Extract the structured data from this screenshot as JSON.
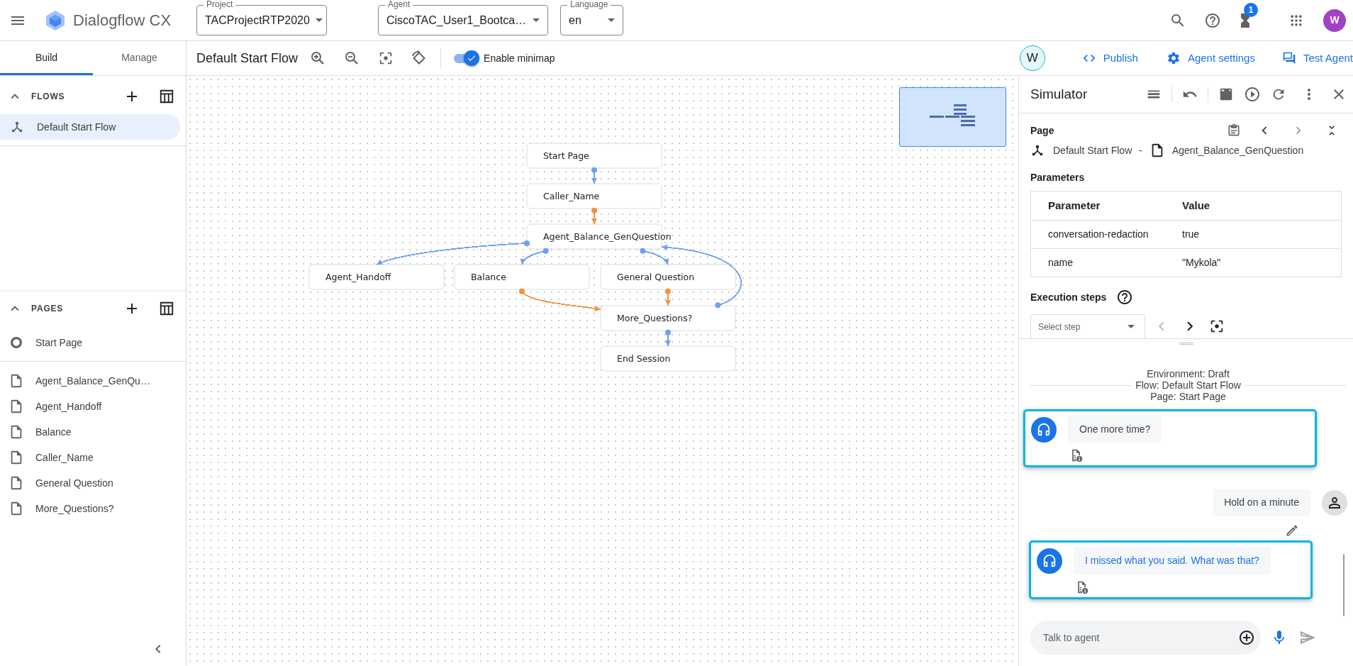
{
  "app": {
    "title": "Dialogflow CX",
    "notifications": "1",
    "avatar": "W"
  },
  "selectors": [
    {
      "label": "Project",
      "value": "TACProjectRTP2020"
    },
    {
      "label": "Agent",
      "value": "CiscoTAC_User1_Bootca…"
    },
    {
      "label": "Language",
      "value": "en"
    }
  ],
  "sidebar_tabs": [
    {
      "label": "Build",
      "selected": true
    },
    {
      "label": "Manage",
      "selected": false
    }
  ],
  "toolbar": {
    "flow_title": "Default Start Flow",
    "minimap": {
      "label": "Enable minimap",
      "on": true
    },
    "collaborator": "W",
    "actions": [
      {
        "kind": "publish",
        "label": "Publish"
      },
      {
        "kind": "settings",
        "label": "Agent settings"
      },
      {
        "kind": "test",
        "label": "Test Agent"
      }
    ]
  },
  "flows": {
    "header": "FLOWS",
    "expanded": true,
    "items": [
      {
        "label": "Default Start Flow",
        "selected": true
      }
    ]
  },
  "pages": {
    "header": "PAGES",
    "expanded": true,
    "start": "Start Page",
    "items": [
      "Agent_Balance_GenQu…",
      "Agent_Handoff",
      "Balance",
      "Caller_Name",
      "General Question",
      "More_Questions?"
    ]
  },
  "canvas": {
    "nodes": [
      "Start Page",
      "Caller_Name",
      "Agent_Balance_GenQuestion",
      "Agent_Handoff",
      "Balance",
      "General Question",
      "More_Questions?",
      "End Session"
    ],
    "edges": [
      {
        "color": "#6ea1f2"
      },
      {
        "color": "#f5923e"
      },
      {
        "color": "#6ea1f2"
      },
      {
        "color": "#6ea1f2"
      },
      {
        "color": "#6ea1f2"
      },
      {
        "color": "#f5923e"
      },
      {
        "color": "#f5923e"
      },
      {
        "color": "#6ea1f2"
      },
      {
        "color": "#6ea1f2"
      }
    ]
  },
  "simulator": {
    "title": "Simulator",
    "page": {
      "heading": "Page",
      "flow": "Default Start Flow",
      "separator": "-",
      "page": "Agent_Balance_GenQuestion"
    },
    "parameters": {
      "heading": "Parameters",
      "columns": [
        "Parameter",
        "Value"
      ],
      "rows": [
        [
          "conversation-redaction",
          "true"
        ],
        [
          "name",
          "\"Mykola\""
        ]
      ]
    },
    "execution": {
      "heading": "Execution steps",
      "placeholder": "Select step"
    },
    "context": [
      "Environment: Draft",
      "Flow: Default Start Flow",
      "Page: Start Page"
    ],
    "messages": [
      {
        "kind": "agent",
        "text": "One more time?",
        "highlighted": true,
        "current": false
      },
      {
        "kind": "user",
        "text": "Hold on a minute"
      },
      {
        "kind": "agent",
        "text": "I missed what you said. What was that?",
        "highlighted": true,
        "current": true
      }
    ],
    "input": {
      "placeholder": "Talk to agent"
    }
  }
}
